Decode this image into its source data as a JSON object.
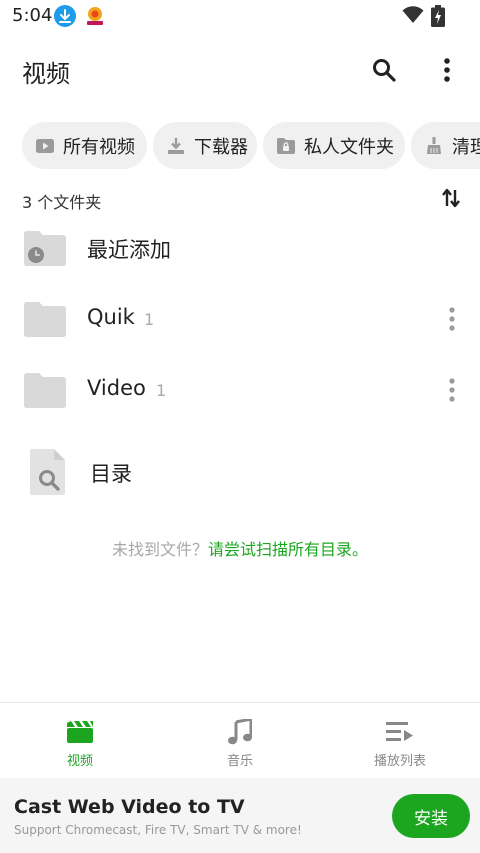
{
  "status_bar": {
    "time": "5:04"
  },
  "app_bar": {
    "title": "视频"
  },
  "chips": [
    {
      "label": "所有视频",
      "icon": "play-box-icon"
    },
    {
      "label": "下载器",
      "icon": "download-icon"
    },
    {
      "label": "私人文件夹",
      "icon": "lock-folder-icon"
    },
    {
      "label": "清理",
      "icon": "broom-icon"
    }
  ],
  "folders": {
    "count_label": "3 个文件夹",
    "recent": {
      "name": "最近添加"
    },
    "items": [
      {
        "name": "Quik",
        "count": "1"
      },
      {
        "name": "Video",
        "count": "1"
      }
    ],
    "directory": {
      "name": "目录"
    }
  },
  "empty_hint": {
    "prefix": "未找到文件？",
    "action": "请尝试扫描所有目录。"
  },
  "bottom_nav": [
    {
      "label": "视频",
      "icon": "video-clapper-icon",
      "active": true
    },
    {
      "label": "音乐",
      "icon": "music-note-icon",
      "active": false
    },
    {
      "label": "播放列表",
      "icon": "playlist-icon",
      "active": false
    }
  ],
  "ad": {
    "title": "Cast Web Video to TV",
    "subtitle": "Support Chromecast, Fire TV, Smart TV & more!",
    "install_label": "安装"
  },
  "colors": {
    "accent": "#1ca620",
    "chip_bg": "#f0f0f0",
    "folder": "#d9d9d9"
  }
}
